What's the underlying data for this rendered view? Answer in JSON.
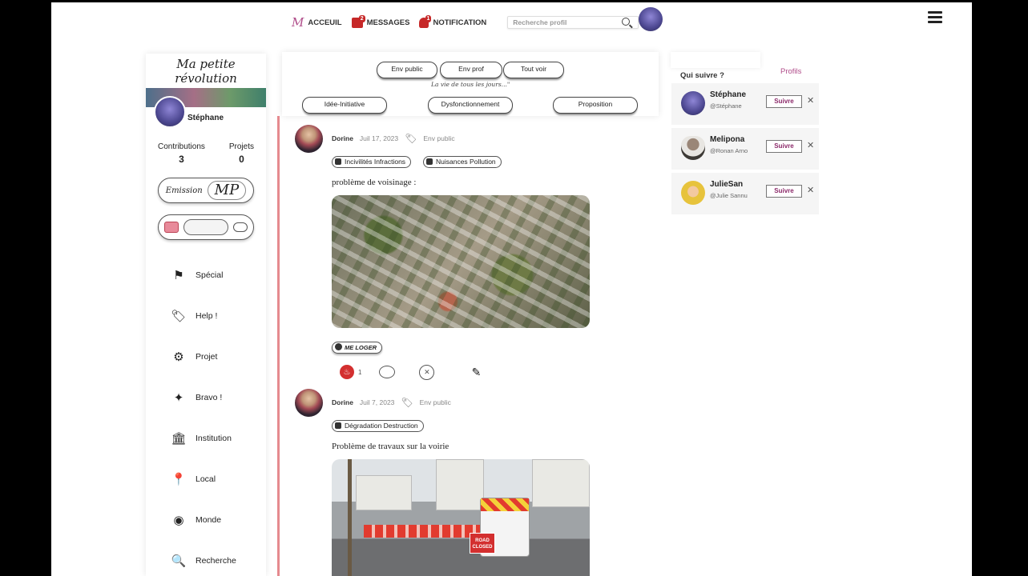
{
  "nav": {
    "items": [
      {
        "label": "ACCEUIL"
      },
      {
        "label": "MESSAGES",
        "count": "2"
      },
      {
        "label": "NOTIFICATION",
        "count": "1"
      }
    ],
    "search_placeholder": "Recherche profil"
  },
  "sidebar": {
    "brand": "Ma petite révolution",
    "user_name": "Stéphane",
    "contributions_label": "Contributions",
    "contributions_value": "3",
    "projects_label": "Projets",
    "projects_value": "0",
    "emission_label": "Emission",
    "signature": "MP",
    "menu": [
      {
        "label": "Spécial",
        "icon": "special-icon"
      },
      {
        "label": "Help !",
        "icon": "help-tag-icon"
      },
      {
        "label": "Projet",
        "icon": "gears-icon"
      },
      {
        "label": "Bravo !",
        "icon": "bravo-icon"
      },
      {
        "label": "Institution",
        "icon": "institution-icon"
      },
      {
        "label": "Local",
        "icon": "pin-icon"
      },
      {
        "label": "Monde",
        "icon": "eye-icon"
      },
      {
        "label": "Recherche",
        "icon": "search-icon"
      }
    ]
  },
  "filters": {
    "env_public": "Env public",
    "env_prof": "Env prof",
    "tout_voir": "Tout voir",
    "tagline": "La vie de tous les jours...\"",
    "idee": "Idée-Initiative",
    "dysfonctionnement": "Dysfonctionnement",
    "proposition": "Proposition"
  },
  "posts": [
    {
      "author": "Dorine",
      "date": "Juil 17, 2023",
      "env": "Env public",
      "categories": [
        "Incivilités Infractions",
        "Nuisances Pollution"
      ],
      "text": "problème de voisinage :",
      "badge": "ME LOGER",
      "fire_count": "1"
    },
    {
      "author": "Dorine",
      "date": "Juil 7, 2023",
      "env": "Env public",
      "categories": [
        "Dégradation Destruction"
      ],
      "text": "Problème de travaux sur la voirie",
      "sign_text": "ROAD CLOSED"
    }
  ],
  "right_panel": {
    "title": "Qui suivre ?",
    "link": "Profils",
    "suggestions": [
      {
        "name": "Stéphane",
        "handle": "@Stéphane",
        "follow": "Suivre"
      },
      {
        "name": "Melipona",
        "handle": "@Ronan Arno",
        "follow": "Suivre"
      },
      {
        "name": "JulieSan",
        "handle": "@Julie Sannu",
        "follow": "Suivre"
      }
    ]
  },
  "colors": {
    "accent": "#b04d8a",
    "feed_border": "#e58a8f",
    "notification_red": "#c62828"
  }
}
